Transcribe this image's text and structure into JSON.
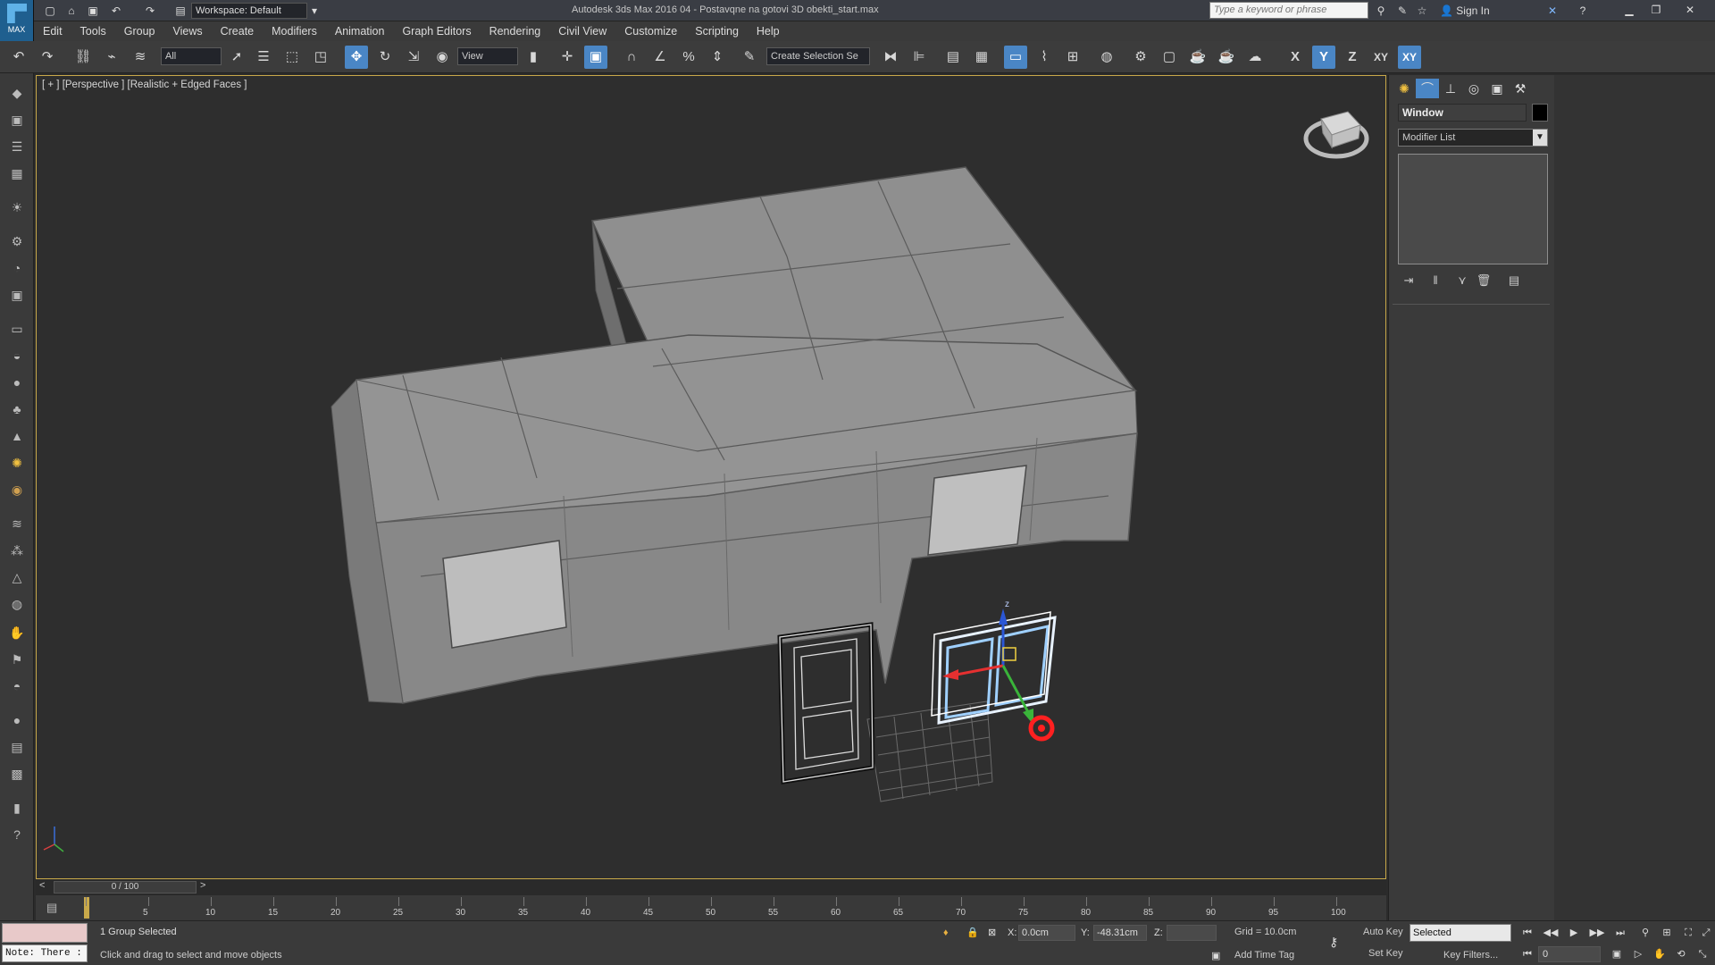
{
  "app": {
    "workspace": "Workspace: Default",
    "window_title": "Autodesk 3ds Max 2016     04 - Postavqne na gotovi 3D obekti_start.max",
    "search_placeholder": "Type a keyword or phrase",
    "signin": "Sign In",
    "logo_text": "MAX"
  },
  "menu": [
    "Edit",
    "Tools",
    "Group",
    "Views",
    "Create",
    "Modifiers",
    "Animation",
    "Graph Editors",
    "Rendering",
    "Civil View",
    "Customize",
    "Scripting",
    "Help"
  ],
  "toolbar": {
    "filter": "All",
    "refcoord": "View",
    "selset": "Create Selection Se",
    "axis_x": "X",
    "axis_y": "Y",
    "axis_z": "Z",
    "axis_xy": "XY",
    "axis_xy2": "XY"
  },
  "viewport": {
    "label": "[ + ] [Perspective ] [Realistic + Edged Faces ]",
    "gizmo_z": "z"
  },
  "panel": {
    "object_name": "Window",
    "modifier_list": "Modifier List"
  },
  "timeslider": {
    "frame": "0 / 100",
    "ticks": [
      "0",
      "5",
      "10",
      "15",
      "20",
      "25",
      "30",
      "35",
      "40",
      "45",
      "50",
      "55",
      "60",
      "65",
      "70",
      "75",
      "80",
      "85",
      "90",
      "95",
      "100"
    ]
  },
  "status": {
    "maxscript": "Note: There :",
    "selection": "1 Group Selected",
    "prompt": "Click and drag to select and move objects",
    "x_label": "X:",
    "x_value": "0.0cm",
    "y_label": "Y:",
    "y_value": "-48.31cm",
    "z_label": "Z:",
    "z_value": "",
    "grid": "Grid = 10.0cm",
    "add_time_tag": "Add Time Tag",
    "auto_key": "Auto Key",
    "set_key": "Set Key",
    "selected": "Selected",
    "key_filters": "Key Filters...",
    "frame_value": "0"
  },
  "colors": {
    "viewport_border": "#c9a94a",
    "active_tool": "#4a86c5",
    "gizmo_x": "#e53030",
    "gizmo_y": "#3ab43a",
    "gizmo_z": "#2b57d6"
  }
}
